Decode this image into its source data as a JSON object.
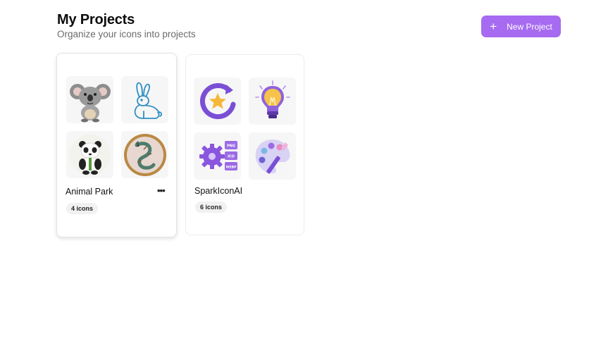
{
  "header": {
    "title": "My Projects",
    "subtitle": "Organize your icons into projects",
    "new_project_label": "New Project",
    "new_project_icon": "plus-icon"
  },
  "projects": [
    {
      "name": "Animal Park",
      "count_label": "4 icons",
      "more_icon": "more-horizontal-icon",
      "thumbnails": [
        "koala-icon",
        "rabbit-icon",
        "panda-icon",
        "dragon-medallion-icon"
      ]
    },
    {
      "name": "SparkIconAI",
      "count_label": "6 icons",
      "thumbnails": [
        "star-refresh-icon",
        "lightbulb-icon",
        "gear-file-formats-icon",
        "palette-brush-icon"
      ],
      "format_labels": [
        "PNG",
        "ICO",
        "WEBP"
      ]
    }
  ],
  "colors": {
    "accent": "#a66bf0",
    "text_primary": "#0d0d0d",
    "text_secondary": "#6b6b6b",
    "badge_bg": "#f1f1f1"
  }
}
